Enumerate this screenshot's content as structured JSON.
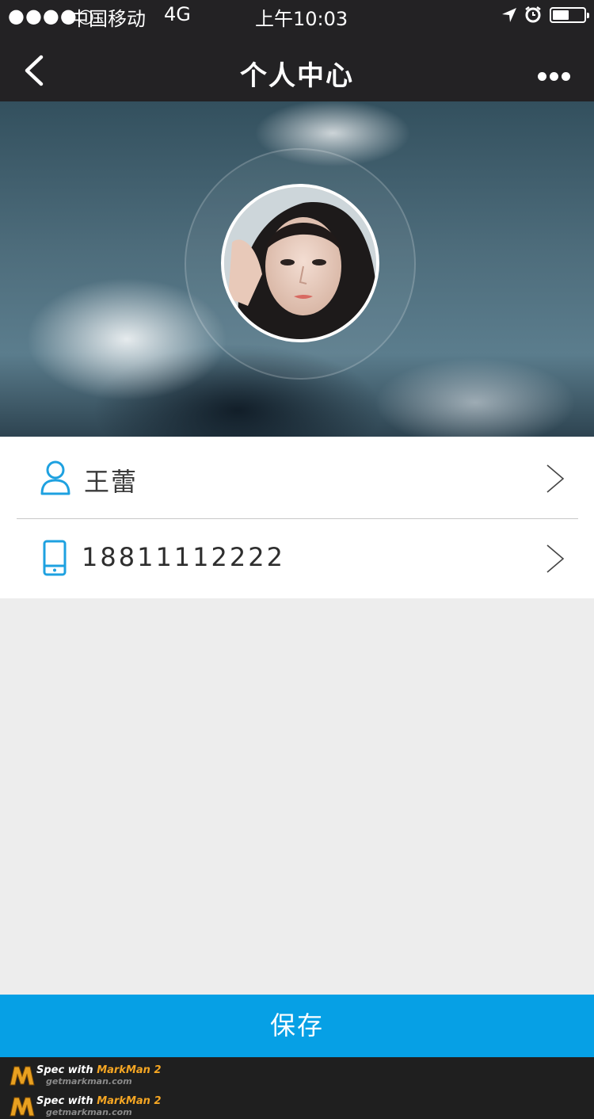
{
  "status_bar": {
    "signal": "●●●●○",
    "carrier": "中国移动",
    "network": "4G",
    "time": "上午10:03",
    "icons": [
      "location-arrow-icon",
      "alarm-clock-icon",
      "battery-icon"
    ]
  },
  "nav": {
    "title": "个人中心",
    "back_icon": "chevron-left-icon",
    "more_icon": "more-dots-icon"
  },
  "profile": {
    "avatar": "avatar-photo",
    "name": "王蕾",
    "name_icon": "user-icon",
    "phone": "18811112222",
    "phone_icon": "phone-icon",
    "chevron_icon": "chevron-right-icon"
  },
  "actions": {
    "save_label": "保存"
  },
  "footer": {
    "spec_prefix": "Spec with ",
    "brand": "MarkMan 2",
    "url": "getmarkman.com"
  },
  "colors": {
    "header_bg": "#232224",
    "accent": "#06a0e5",
    "page_bg": "#ededed",
    "icon_blue": "#1ea1e0"
  }
}
